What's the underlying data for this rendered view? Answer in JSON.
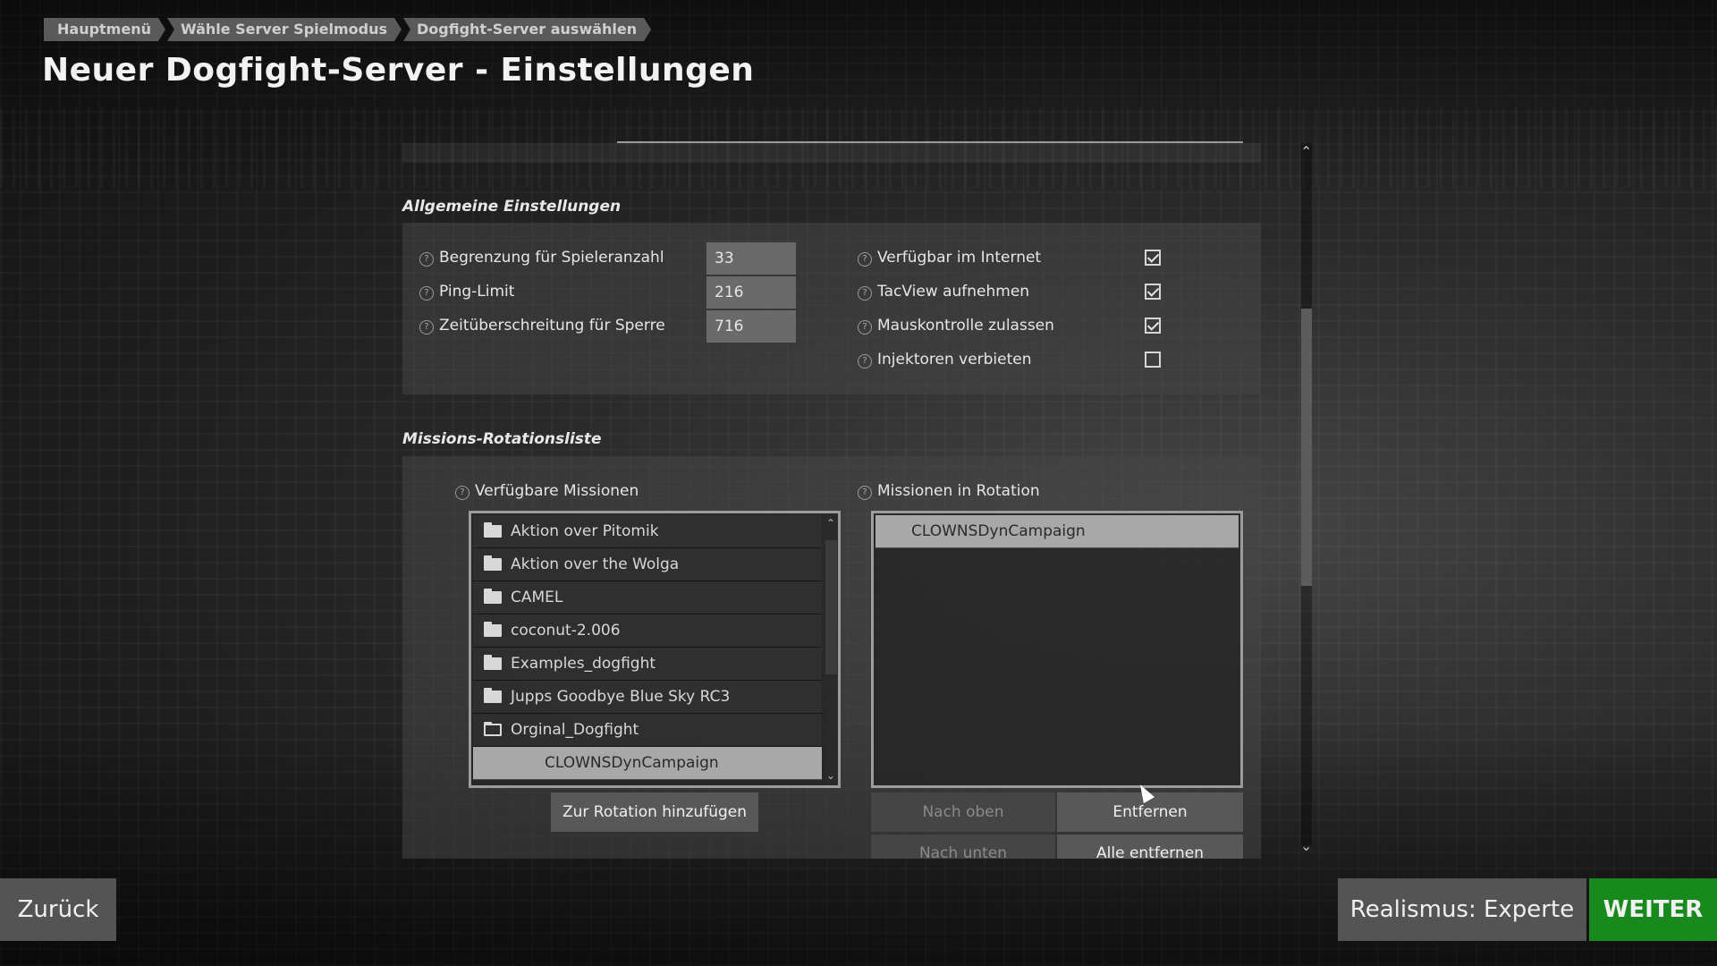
{
  "breadcrumb": [
    "Hauptmenü",
    "Wähle Server Spielmodus",
    "Dogfight-Server auswählen"
  ],
  "page_title": "Neuer Dogfight-Server - Einstellungen",
  "general": {
    "title": "Allgemeine Einstellungen",
    "fields": [
      {
        "label": "Begrenzung für Spieleranzahl",
        "value": "33"
      },
      {
        "label": "Ping-Limit",
        "value": "216"
      },
      {
        "label": "Zeitüberschreitung für Sperre",
        "value": "716"
      }
    ],
    "options": [
      {
        "label": "Verfügbar im Internet",
        "checked": true
      },
      {
        "label": "TacView aufnehmen",
        "checked": true
      },
      {
        "label": "Mauskontrolle zulassen",
        "checked": true
      },
      {
        "label": "Injektoren verbieten",
        "checked": false
      }
    ]
  },
  "rotation": {
    "title": "Missions-Rotationsliste",
    "available_label": "Verfügbare Missionen",
    "in_rotation_label": "Missionen in Rotation",
    "available": [
      {
        "name": "Aktion over Pitomik",
        "icon": "folder-icon"
      },
      {
        "name": "Aktion over the Wolga",
        "icon": "folder-icon"
      },
      {
        "name": "CAMEL",
        "icon": "folder-icon"
      },
      {
        "name": "coconut-2.006",
        "icon": "folder-icon"
      },
      {
        "name": "Examples_dogfight",
        "icon": "folder-icon"
      },
      {
        "name": "Jupps Goodbye Blue Sky RC3",
        "icon": "folder-icon"
      },
      {
        "name": "Orginal_Dogfight",
        "icon": "folder-open-icon"
      },
      {
        "name": "CLOWNSDynCampaign",
        "icon": "none"
      }
    ],
    "in_rotation": [
      "CLOWNSDynCampaign"
    ],
    "add_button": "Zur Rotation hinzufügen",
    "up_button": "Nach oben",
    "remove_button": "Entfernen",
    "down_button": "Nach unten",
    "remove_all_button": "Alle entfernen"
  },
  "footer": {
    "back": "Zurück",
    "realism": "Realismus: Experte",
    "next": "WEITER"
  },
  "colors": {
    "next_button": "#17891d",
    "panel": "#464646",
    "selected": "#a8a8a8"
  }
}
